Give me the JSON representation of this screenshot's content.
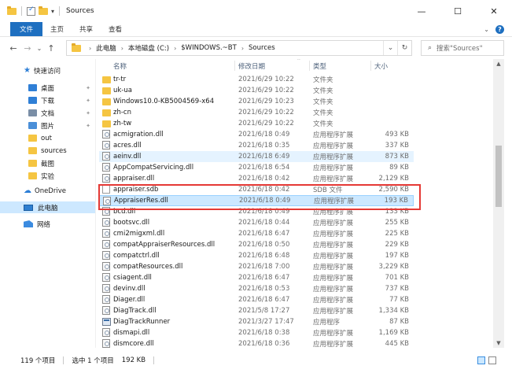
{
  "window": {
    "title": "Sources",
    "controls": [
      "—",
      "☐",
      "✕"
    ]
  },
  "ribbon": {
    "tabs": [
      "文件",
      "主页",
      "共享",
      "查看"
    ]
  },
  "address": {
    "crumbs": [
      "此电脑",
      "本地磁盘 (C:)",
      "$WINDOWS.~BT",
      "Sources"
    ]
  },
  "search": {
    "placeholder": "搜索\"Sources\""
  },
  "nav": {
    "quick_access": "快速访问",
    "items": [
      {
        "label": "桌面",
        "pinned": true,
        "color": "#2f7fd6"
      },
      {
        "label": "下载",
        "pinned": true,
        "color": "#2f7fd6"
      },
      {
        "label": "文档",
        "pinned": true,
        "color": "#7a8ea6"
      },
      {
        "label": "图片",
        "pinned": true,
        "color": "#4a8fd8"
      },
      {
        "label": "out",
        "pinned": false,
        "color": "#f5c542"
      },
      {
        "label": "sources",
        "pinned": false,
        "color": "#f5c542"
      },
      {
        "label": "截图",
        "pinned": false,
        "color": "#f5c542"
      },
      {
        "label": "实验",
        "pinned": false,
        "color": "#f5c542"
      }
    ],
    "onedrive": "OneDrive",
    "this_pc": "此电脑",
    "network": "网络"
  },
  "columns": {
    "name": "名称",
    "date": "修改日期",
    "type": "类型",
    "size": "大小"
  },
  "files": [
    {
      "name": "tr-tr",
      "date": "2021/6/29 10:22",
      "type": "文件夹",
      "size": "",
      "icon": "folder"
    },
    {
      "name": "uk-ua",
      "date": "2021/6/29 10:22",
      "type": "文件夹",
      "size": "",
      "icon": "folder"
    },
    {
      "name": "Windows10.0-KB5004569-x64",
      "date": "2021/6/29 10:23",
      "type": "文件夹",
      "size": "",
      "icon": "folder"
    },
    {
      "name": "zh-cn",
      "date": "2021/6/29 10:22",
      "type": "文件夹",
      "size": "",
      "icon": "folder"
    },
    {
      "name": "zh-tw",
      "date": "2021/6/29 10:22",
      "type": "文件夹",
      "size": "",
      "icon": "folder"
    },
    {
      "name": "acmigration.dll",
      "date": "2021/6/18 0:49",
      "type": "应用程序扩展",
      "size": "493 KB",
      "icon": "dll"
    },
    {
      "name": "acres.dll",
      "date": "2021/6/18 0:35",
      "type": "应用程序扩展",
      "size": "337 KB",
      "icon": "dll"
    },
    {
      "name": "aeinv.dll",
      "date": "2021/6/18 6:49",
      "type": "应用程序扩展",
      "size": "873 KB",
      "icon": "dll",
      "state": "hover"
    },
    {
      "name": "AppCompatServicing.dll",
      "date": "2021/6/18 6:54",
      "type": "应用程序扩展",
      "size": "89 KB",
      "icon": "dll"
    },
    {
      "name": "appraiser.dll",
      "date": "2021/6/18 0:42",
      "type": "应用程序扩展",
      "size": "2,129 KB",
      "icon": "dll"
    },
    {
      "name": "appraiser.sdb",
      "date": "2021/6/18 0:42",
      "type": "SDB 文件",
      "size": "2,590 KB",
      "icon": "sdb"
    },
    {
      "name": "AppraiserRes.dll",
      "date": "2021/6/18 0:49",
      "type": "应用程序扩展",
      "size": "193 KB",
      "icon": "dll",
      "state": "selected"
    },
    {
      "name": "bcd.dll",
      "date": "2021/6/18 0:49",
      "type": "应用程序扩展",
      "size": "133 KB",
      "icon": "dll"
    },
    {
      "name": "bootsvc.dll",
      "date": "2021/6/18 0:44",
      "type": "应用程序扩展",
      "size": "255 KB",
      "icon": "dll"
    },
    {
      "name": "cmi2migxml.dll",
      "date": "2021/6/18 6:47",
      "type": "应用程序扩展",
      "size": "225 KB",
      "icon": "dll"
    },
    {
      "name": "compatAppraiserResources.dll",
      "date": "2021/6/18 0:50",
      "type": "应用程序扩展",
      "size": "229 KB",
      "icon": "dll"
    },
    {
      "name": "compatctrl.dll",
      "date": "2021/6/18 6:48",
      "type": "应用程序扩展",
      "size": "197 KB",
      "icon": "dll"
    },
    {
      "name": "compatResources.dll",
      "date": "2021/6/18 7:00",
      "type": "应用程序扩展",
      "size": "3,229 KB",
      "icon": "dll"
    },
    {
      "name": "csiagent.dll",
      "date": "2021/6/18 6:47",
      "type": "应用程序扩展",
      "size": "701 KB",
      "icon": "dll"
    },
    {
      "name": "devinv.dll",
      "date": "2021/6/18 0:53",
      "type": "应用程序扩展",
      "size": "737 KB",
      "icon": "dll"
    },
    {
      "name": "Diager.dll",
      "date": "2021/6/18 6:47",
      "type": "应用程序扩展",
      "size": "77 KB",
      "icon": "dll"
    },
    {
      "name": "DiagTrack.dll",
      "date": "2021/5/8 17:27",
      "type": "应用程序扩展",
      "size": "1,334 KB",
      "icon": "dll"
    },
    {
      "name": "DiagTrackRunner",
      "date": "2021/3/27 17:47",
      "type": "应用程序",
      "size": "87 KB",
      "icon": "exe"
    },
    {
      "name": "dismapi.dll",
      "date": "2021/6/18 0:38",
      "type": "应用程序扩展",
      "size": "1,169 KB",
      "icon": "dll"
    },
    {
      "name": "dismcore.dll",
      "date": "2021/6/18 0:36",
      "type": "应用程序扩展",
      "size": "445 KB",
      "icon": "dll"
    }
  ],
  "status": {
    "count": "119 个项目",
    "selected": "选中 1 个项目",
    "size": "192 KB"
  }
}
